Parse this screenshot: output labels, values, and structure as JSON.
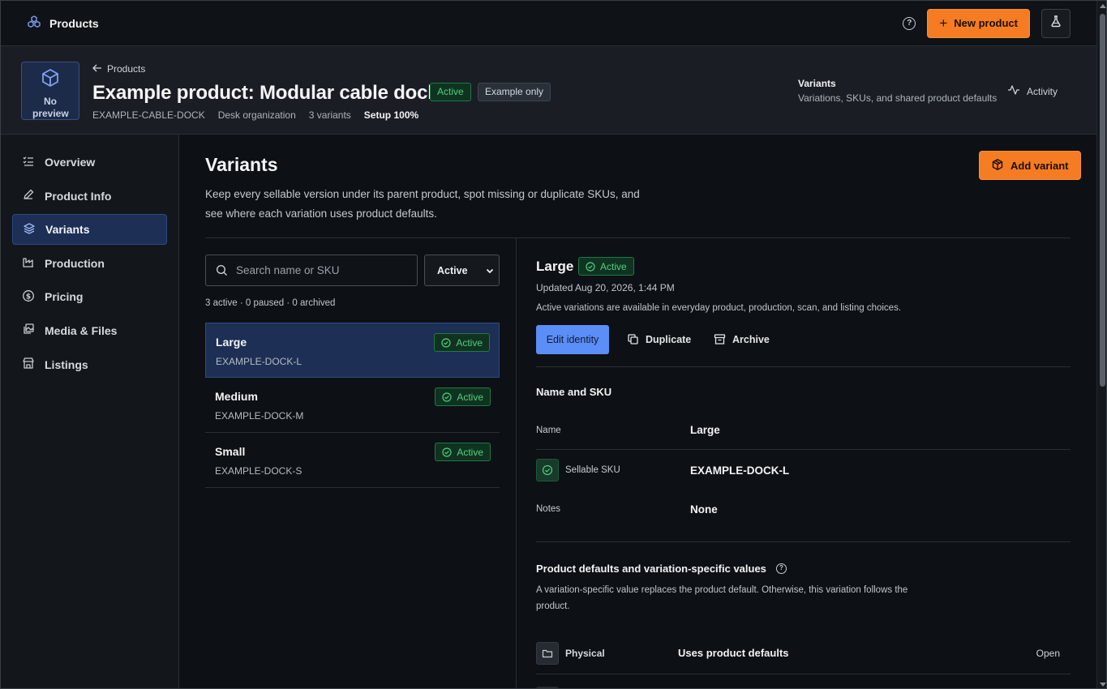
{
  "topbar": {
    "brand": "Products",
    "new_product": "New product",
    "help_icon": "question-circle-icon",
    "lab_icon": "flask-icon",
    "accent": "#f57c22"
  },
  "product": {
    "preview_text": "No preview",
    "back_label": "Products",
    "title": "Example product: Modular cable dock",
    "status": "Active",
    "example_tag": "Example only",
    "sku": "EXAMPLE-CABLE-DOCK",
    "category": "Desk organization",
    "variant_count": "3 variants",
    "setup": "Setup 100%",
    "context_title": "Variants",
    "context_subtitle": "Variations, SKUs, and shared product defaults",
    "activity": "Activity"
  },
  "sidebar": {
    "items": [
      {
        "label": "Overview",
        "icon": "list-check-icon"
      },
      {
        "label": "Product Info",
        "icon": "pencil-icon"
      },
      {
        "label": "Variants",
        "icon": "layers-icon",
        "active": true
      },
      {
        "label": "Production",
        "icon": "factory-icon"
      },
      {
        "label": "Pricing",
        "icon": "dollar-circle-icon"
      },
      {
        "label": "Media & Files",
        "icon": "images-icon"
      },
      {
        "label": "Listings",
        "icon": "store-icon"
      }
    ]
  },
  "main": {
    "title": "Variants",
    "description": "Keep every sellable version under its parent product, spot missing or duplicate SKUs, and see where each variation uses product defaults.",
    "add_variant": "Add variant",
    "search_placeholder": "Search name or SKU",
    "filter_value": "Active",
    "counts": "3 active · 0 paused · 0 archived",
    "variants": [
      {
        "name": "Large",
        "sku": "EXAMPLE-DOCK-L",
        "status": "Active",
        "selected": true
      },
      {
        "name": "Medium",
        "sku": "EXAMPLE-DOCK-M",
        "status": "Active"
      },
      {
        "name": "Small",
        "sku": "EXAMPLE-DOCK-S",
        "status": "Active"
      }
    ]
  },
  "detail": {
    "name": "Large",
    "status": "Active",
    "updated": "Updated Aug 20, 2026, 1:44 PM",
    "info": "Active variations are available in everyday product, production, scan, and listing choices.",
    "edit_identity": "Edit identity",
    "duplicate": "Duplicate",
    "archive": "Archive",
    "section_title": "Name and SKU",
    "fields": [
      {
        "key": "Name",
        "value": "Large"
      },
      {
        "key": "Sellable SKU",
        "value": "EXAMPLE-DOCK-L"
      },
      {
        "key": "Notes",
        "value": "None"
      }
    ],
    "defaults_title": "Product defaults and variation-specific values",
    "defaults_desc": "A variation-specific value replaces the product default. Otherwise, this variation follows the product.",
    "physical": {
      "key": "Physical",
      "value": "Uses product defaults",
      "action": "Open"
    }
  }
}
